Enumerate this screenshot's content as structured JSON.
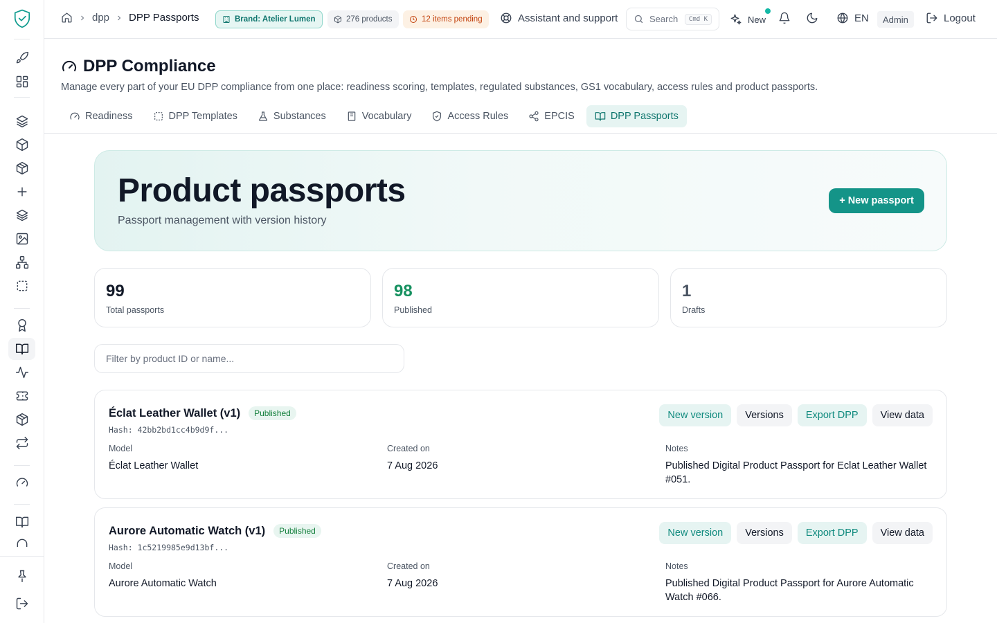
{
  "breadcrumb": {
    "segment": "dpp",
    "current": "DPP Passports"
  },
  "topbar": {
    "brand": "Brand: Atelier Lumen",
    "products": "276 products",
    "pending": "12 items pending",
    "assistant": "Assistant and support",
    "search_label": "Search",
    "search_shortcut": "Cmd K",
    "new_label": "New",
    "language": "EN",
    "role": "Admin",
    "logout": "Logout"
  },
  "page": {
    "title": "DPP Compliance",
    "description": "Manage every part of your EU DPP compliance from one place: readiness scoring, templates, regulated substances, GS1 vocabulary, access rules and product passports."
  },
  "tabs": [
    {
      "label": "Readiness",
      "icon": "gauge-icon",
      "active": false
    },
    {
      "label": "DPP Templates",
      "icon": "dashed-square-icon",
      "active": false
    },
    {
      "label": "Substances",
      "icon": "flask-icon",
      "active": false
    },
    {
      "label": "Vocabulary",
      "icon": "book-icon",
      "active": false
    },
    {
      "label": "Access Rules",
      "icon": "shield-icon",
      "active": false
    },
    {
      "label": "EPCIS",
      "icon": "share-icon",
      "active": false
    },
    {
      "label": "DPP Passports",
      "icon": "book-open-icon",
      "active": true
    }
  ],
  "hero": {
    "title": "Product passports",
    "subtitle": "Passport management with version history",
    "new_button": "+ New passport"
  },
  "stats": [
    {
      "value": "99",
      "label": "Total passports",
      "color": "#111827"
    },
    {
      "value": "98",
      "label": "Published",
      "color": "#15905f"
    },
    {
      "value": "1",
      "label": "Drafts",
      "color": "#4b5563"
    }
  ],
  "filter": {
    "placeholder": "Filter by product ID or name..."
  },
  "labels": {
    "model": "Model",
    "created": "Created on",
    "notes": "Notes",
    "new_version": "New version",
    "versions": "Versions",
    "export": "Export DPP",
    "view": "View data"
  },
  "passports": [
    {
      "name": "Éclat Leather Wallet (v1)",
      "status": "Published",
      "hash": "Hash: 42bb2bd1cc4b9d9f...",
      "model": "Éclat Leather Wallet",
      "created": "7 Aug 2026",
      "notes": "Published Digital Product Passport for Eclat Leather Wallet #051."
    },
    {
      "name": "Aurore Automatic Watch (v1)",
      "status": "Published",
      "hash": "Hash: 1c5219985e9d13bf...",
      "model": "Aurore Automatic Watch",
      "created": "7 Aug 2026",
      "notes": "Published Digital Product Passport for Aurore Automatic Watch #066."
    }
  ],
  "colors": {
    "accent": "#149488",
    "accent_light": "#e6f4f2",
    "border": "#e5e7eb"
  }
}
